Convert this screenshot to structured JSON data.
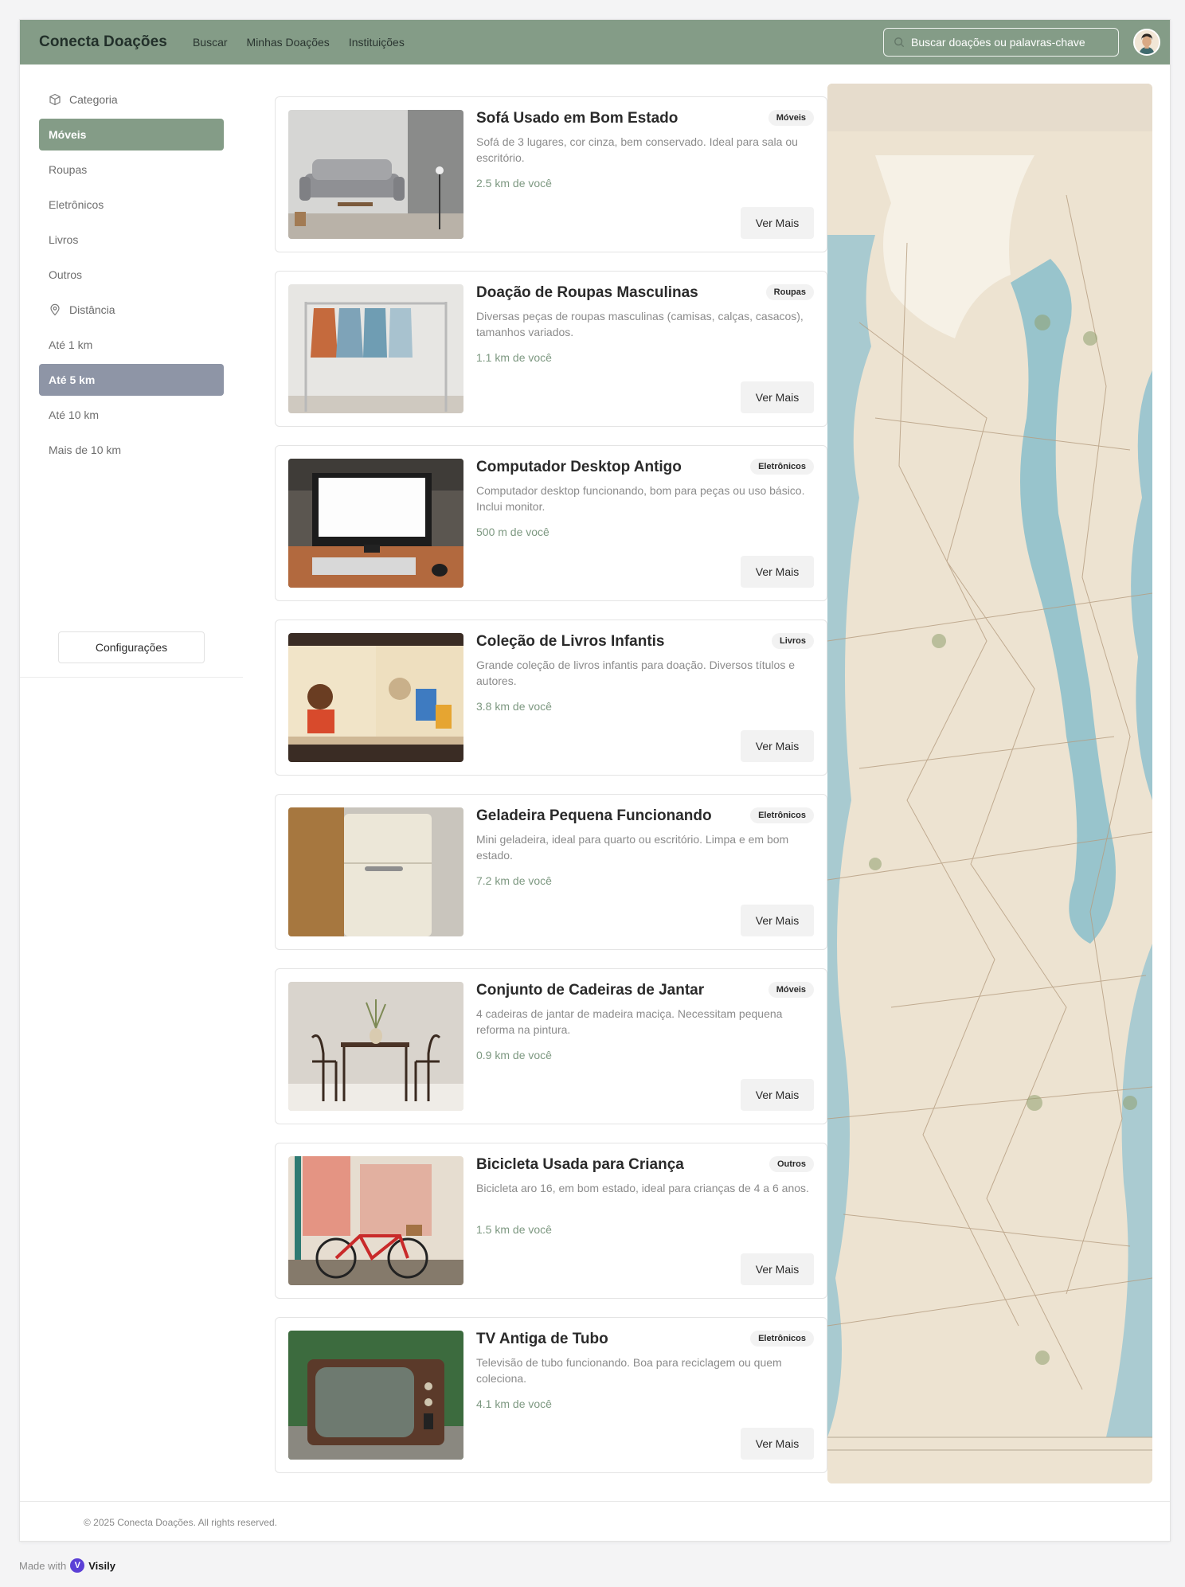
{
  "header": {
    "brand": "Conecta Doações",
    "nav": [
      "Buscar",
      "Minhas Doações",
      "Instituições"
    ],
    "search_placeholder": "Buscar doações ou palavras-chave",
    "colors": {
      "header_bg": "#849c87"
    }
  },
  "sidebar": {
    "category_heading": "Categoria",
    "categories": [
      {
        "label": "Móveis",
        "active": true
      },
      {
        "label": "Roupas",
        "active": false
      },
      {
        "label": "Eletrônicos",
        "active": false
      },
      {
        "label": "Livros",
        "active": false
      },
      {
        "label": "Outros",
        "active": false
      }
    ],
    "distance_heading": "Distância",
    "distances": [
      {
        "label": "Até 1 km",
        "active": false
      },
      {
        "label": "Até 5 km",
        "active": true
      },
      {
        "label": "Até 10 km",
        "active": false
      },
      {
        "label": "Mais de 10 km",
        "active": false
      }
    ],
    "settings_label": "Configurações",
    "colors": {
      "active_category": "#849c87",
      "active_distance": "#8e95a6"
    }
  },
  "listings": [
    {
      "title": "Sofá Usado em Bom Estado",
      "badge": "Móveis",
      "description": "Sofá de 3 lugares, cor cinza, bem conservado. Ideal para sala ou escritório.",
      "distance": "2.5 km de você",
      "button": "Ver Mais",
      "image": "sofa"
    },
    {
      "title": "Doação de Roupas Masculinas",
      "badge": "Roupas",
      "description": "Diversas peças de roupas masculinas (camisas, calças, casacos), tamanhos variados.",
      "distance": "1.1 km de você",
      "button": "Ver Mais",
      "image": "clothes-rack"
    },
    {
      "title": "Computador Desktop Antigo",
      "badge": "Eletrônicos",
      "description": "Computador desktop funcionando, bom para peças ou uso básico. Inclui monitor.",
      "distance": "500 m de você",
      "button": "Ver Mais",
      "image": "desktop-computer"
    },
    {
      "title": "Coleção de Livros Infantis",
      "badge": "Livros",
      "description": "Grande coleção de livros infantis para doação. Diversos títulos e autores.",
      "distance": "3.8 km de você",
      "button": "Ver Mais",
      "image": "childrens-books"
    },
    {
      "title": "Geladeira Pequena Funcionando",
      "badge": "Eletrônicos",
      "description": "Mini geladeira, ideal para quarto ou escritório. Limpa e em bom estado.",
      "distance": "7.2 km de você",
      "button": "Ver Mais",
      "image": "mini-fridge"
    },
    {
      "title": "Conjunto de Cadeiras de Jantar",
      "badge": "Móveis",
      "description": "4 cadeiras de jantar de madeira maciça. Necessitam pequena reforma na pintura.",
      "distance": "0.9 km de você",
      "button": "Ver Mais",
      "image": "dining-chairs"
    },
    {
      "title": "Bicicleta Usada para Criança",
      "badge": "Outros",
      "description": "Bicicleta aro 16, em bom estado, ideal para crianças de 4 a 6 anos.",
      "distance": "1.5 km de você",
      "button": "Ver Mais",
      "image": "kids-bicycle"
    },
    {
      "title": "TV Antiga de Tubo",
      "badge": "Eletrônicos",
      "description": "Televisão de tubo funcionando. Boa para reciclagem ou quem coleciona.",
      "distance": "4.1 km de você",
      "button": "Ver Mais",
      "image": "crt-tv"
    }
  ],
  "map": {
    "image": "vintage-map"
  },
  "footer": {
    "copyright": "© 2025 Conecta Doações. All rights reserved."
  },
  "badge_made_with": {
    "prefix": "Made with",
    "brand": "Visily"
  }
}
